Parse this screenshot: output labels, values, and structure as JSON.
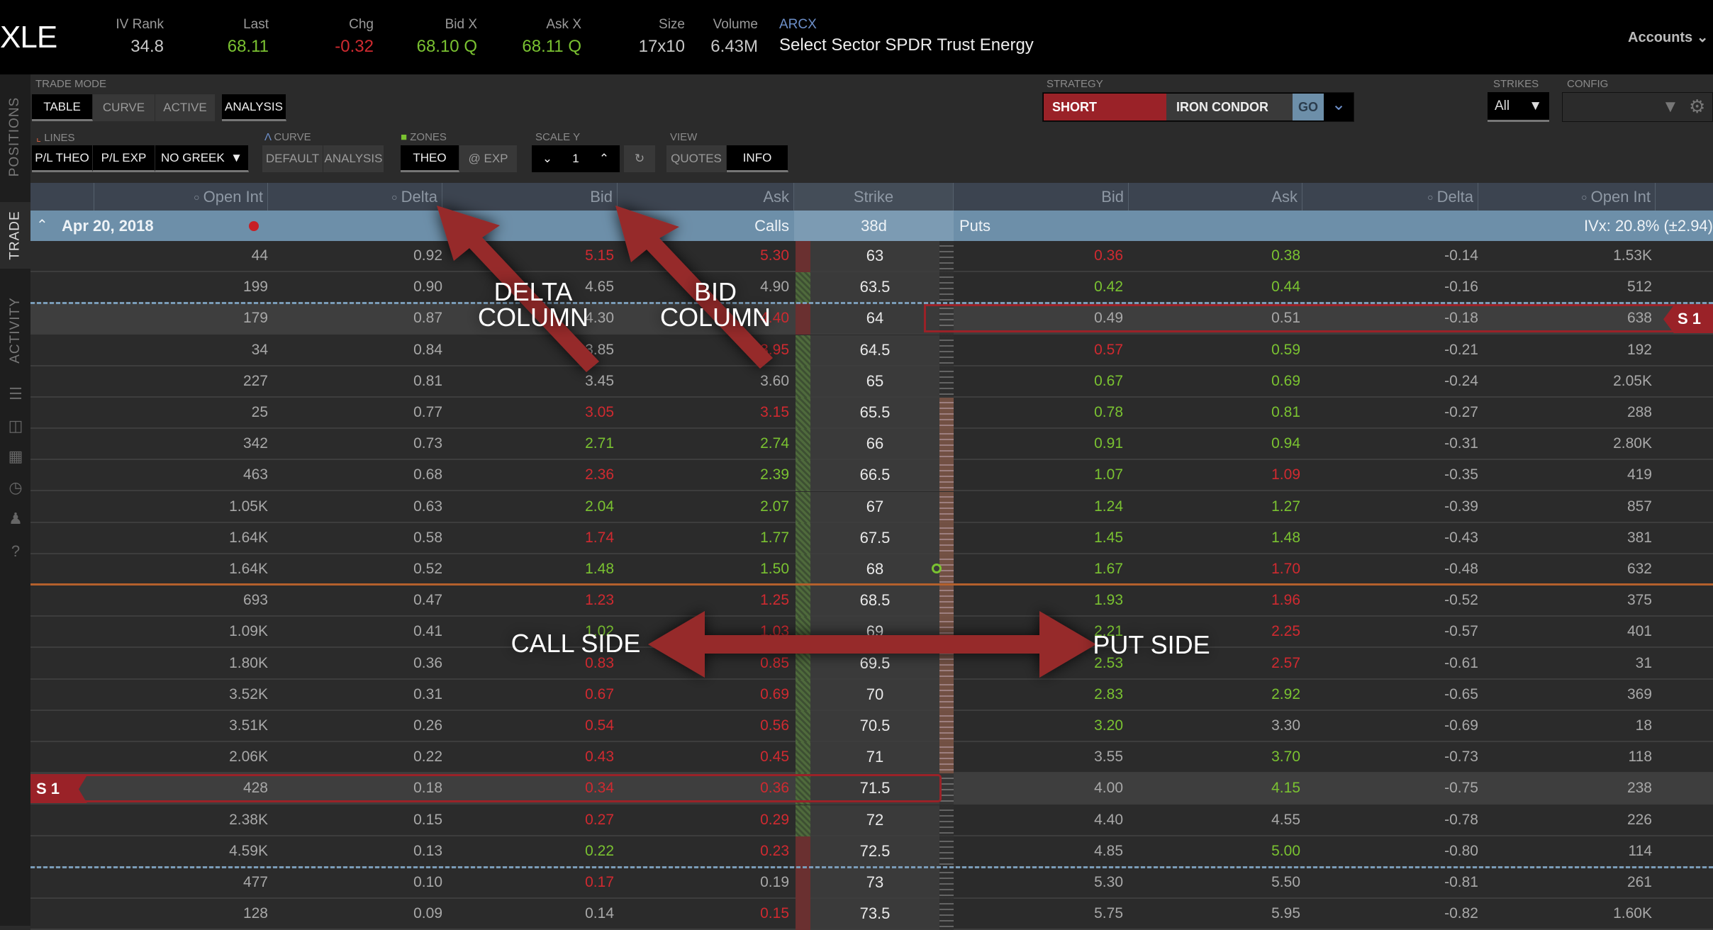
{
  "header": {
    "symbol": "XLE",
    "quotes": [
      {
        "label": "IV Rank",
        "value": "34.8",
        "color": "n"
      },
      {
        "label": "Last",
        "value": "68.11",
        "color": "g"
      },
      {
        "label": "Chg",
        "value": "-0.32",
        "color": "r"
      },
      {
        "label": "Bid X",
        "value": "68.10 Q",
        "color": "g"
      },
      {
        "label": "Ask X",
        "value": "68.11 Q",
        "color": "g"
      },
      {
        "label": "Size",
        "value": "17x10",
        "color": "n"
      },
      {
        "label": "Volume",
        "value": "6.43M",
        "color": "n"
      }
    ],
    "exchange": "ARCX",
    "description": "Select Sector SPDR Trust Energy",
    "accounts": "Accounts"
  },
  "sidebar": {
    "tabs": [
      "POSITIONS",
      "TRADE",
      "ACTIVITY"
    ]
  },
  "toolbar": {
    "trade_mode": {
      "label": "TRADE MODE",
      "buttons": [
        "TABLE",
        "CURVE",
        "ACTIVE",
        "ANALYSIS"
      ]
    },
    "lines": {
      "label": "LINES",
      "buttons": [
        "P/L THEO",
        "P/L EXP",
        "NO GREEK"
      ]
    },
    "curve": {
      "label": "CURVE",
      "buttons": [
        "DEFAULT",
        "ANALYSIS"
      ]
    },
    "zones": {
      "label": "ZONES",
      "buttons": [
        "THEO",
        "@ EXP"
      ]
    },
    "scale_y": {
      "label": "SCALE Y",
      "value": "1"
    },
    "view": {
      "label": "VIEW",
      "buttons": [
        "QUOTES",
        "INFO"
      ]
    },
    "strategy": {
      "label": "STRATEGY",
      "side": "SHORT",
      "type": "IRON CONDOR",
      "go": "GO"
    },
    "strikes": {
      "label": "STRIKES",
      "value": "All"
    },
    "config": {
      "label": "CONFIG"
    }
  },
  "columns": {
    "call": [
      "Open Int",
      "Delta",
      "Bid",
      "Ask"
    ],
    "strike": "Strike",
    "put": [
      "Bid",
      "Ask",
      "Delta",
      "Open Int"
    ]
  },
  "expiry": {
    "date": "Apr 20, 2018",
    "calls": "Calls",
    "days": "38d",
    "puts": "Puts",
    "ivx": "IVx: 20.8% (±2.94)"
  },
  "position_tag": "S 1",
  "colors": {
    "up": "#7ac231",
    "down": "#d02a30",
    "accent_red": "#9a2228",
    "go_blue": "#6d8fa9"
  },
  "rows": [
    [
      "44",
      "0.92",
      "5.15",
      "r",
      "5.30",
      "r",
      "63",
      "0.36",
      "r",
      "0.38",
      "g",
      "-0.14",
      "1.53K"
    ],
    [
      "199",
      "0.90",
      "4.65",
      "n",
      "4.90",
      "n",
      "63.5",
      "0.42",
      "g",
      "0.44",
      "g",
      "-0.16",
      "512"
    ],
    [
      "179",
      "0.87",
      "4.30",
      "n",
      "4.40",
      "r",
      "64",
      "0.49",
      "n",
      "0.51",
      "n",
      "-0.18",
      "638"
    ],
    [
      "34",
      "0.84",
      "3.85",
      "n",
      "3.95",
      "r",
      "64.5",
      "0.57",
      "r",
      "0.59",
      "g",
      "-0.21",
      "192"
    ],
    [
      "227",
      "0.81",
      "3.45",
      "n",
      "3.60",
      "n",
      "65",
      "0.67",
      "g",
      "0.69",
      "g",
      "-0.24",
      "2.05K"
    ],
    [
      "25",
      "0.77",
      "3.05",
      "r",
      "3.15",
      "r",
      "65.5",
      "0.78",
      "g",
      "0.81",
      "g",
      "-0.27",
      "288"
    ],
    [
      "342",
      "0.73",
      "2.71",
      "g",
      "2.74",
      "g",
      "66",
      "0.91",
      "g",
      "0.94",
      "g",
      "-0.31",
      "2.80K"
    ],
    [
      "463",
      "0.68",
      "2.36",
      "r",
      "2.39",
      "g",
      "66.5",
      "1.07",
      "g",
      "1.09",
      "r",
      "-0.35",
      "419"
    ],
    [
      "1.05K",
      "0.63",
      "2.04",
      "g",
      "2.07",
      "g",
      "67",
      "1.24",
      "g",
      "1.27",
      "g",
      "-0.39",
      "857"
    ],
    [
      "1.64K",
      "0.58",
      "1.74",
      "r",
      "1.77",
      "g",
      "67.5",
      "1.45",
      "g",
      "1.48",
      "g",
      "-0.43",
      "381"
    ],
    [
      "1.64K",
      "0.52",
      "1.48",
      "g",
      "1.50",
      "g",
      "68",
      "1.67",
      "g",
      "1.70",
      "r",
      "-0.48",
      "632"
    ],
    [
      "693",
      "0.47",
      "1.23",
      "r",
      "1.25",
      "r",
      "68.5",
      "1.93",
      "g",
      "1.96",
      "r",
      "-0.52",
      "375"
    ],
    [
      "1.09K",
      "0.41",
      "1.02",
      "g",
      "1.03",
      "r",
      "69",
      "2.21",
      "g",
      "2.25",
      "r",
      "-0.57",
      "401"
    ],
    [
      "1.80K",
      "0.36",
      "0.83",
      "r",
      "0.85",
      "r",
      "69.5",
      "2.53",
      "g",
      "2.57",
      "r",
      "-0.61",
      "31"
    ],
    [
      "3.52K",
      "0.31",
      "0.67",
      "r",
      "0.69",
      "r",
      "70",
      "2.83",
      "g",
      "2.92",
      "g",
      "-0.65",
      "369"
    ],
    [
      "3.51K",
      "0.26",
      "0.54",
      "r",
      "0.56",
      "r",
      "70.5",
      "3.20",
      "g",
      "3.30",
      "n",
      "-0.69",
      "18"
    ],
    [
      "2.06K",
      "0.22",
      "0.43",
      "r",
      "0.45",
      "r",
      "71",
      "3.55",
      "n",
      "3.70",
      "g",
      "-0.73",
      "118"
    ],
    [
      "428",
      "0.18",
      "0.34",
      "r",
      "0.36",
      "r",
      "71.5",
      "4.00",
      "n",
      "4.15",
      "g",
      "-0.75",
      "238"
    ],
    [
      "2.38K",
      "0.15",
      "0.27",
      "r",
      "0.29",
      "r",
      "72",
      "4.40",
      "n",
      "4.55",
      "n",
      "-0.78",
      "226"
    ],
    [
      "4.59K",
      "0.13",
      "0.22",
      "g",
      "0.23",
      "r",
      "72.5",
      "4.85",
      "n",
      "5.00",
      "g",
      "-0.80",
      "114"
    ],
    [
      "477",
      "0.10",
      "0.17",
      "r",
      "0.19",
      "n",
      "73",
      "5.30",
      "n",
      "5.50",
      "n",
      "-0.81",
      "261"
    ],
    [
      "128",
      "0.09",
      "0.14",
      "n",
      "0.15",
      "r",
      "73.5",
      "5.75",
      "n",
      "5.95",
      "n",
      "-0.82",
      "1.60K"
    ]
  ],
  "annotations": {
    "delta": [
      "DELTA",
      "COLUMN"
    ],
    "bid": [
      "BID",
      "COLUMN"
    ],
    "call_side": "CALL SIDE",
    "put_side": "PUT SIDE"
  }
}
